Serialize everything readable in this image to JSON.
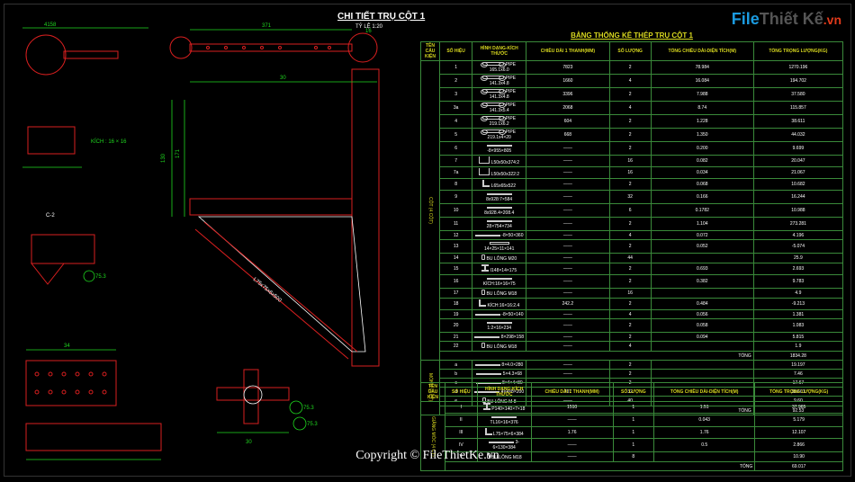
{
  "title": "CHI TIẾT TRỤ CỘT 1",
  "scale": "TỶ LỆ 1:20",
  "logo": {
    "brand_a": "File",
    "brand_b": "Thiết Kế",
    "tld": ".vn"
  },
  "copyright": "Copyright © FileThietKe.vn",
  "dims": {
    "d1": "4158",
    "d2": "371",
    "d3": "16",
    "d4": "30",
    "d5": "171",
    "d6": "130",
    "d7": "75.3",
    "d8": "75.3",
    "d9": "75.3",
    "d10": "34",
    "d11": "30",
    "d12": "75.3",
    "note1": "KÍCH : 16 × 16",
    "note2": "L75x75x6x500"
  },
  "table1": {
    "title": "BẢNG THỐNG KÊ THÉP TRỤ CỘT 1",
    "headers": [
      "TÊN CẤU KIỆN",
      "SỐ HIỆU",
      "HÌNH DẠNG-KÍCH THƯỚC",
      "CHIỀU DÀI 1 THANH(MM)",
      "SỐ LƯỢNG",
      "TỔNG CHIỀU DÀI-DIỆN TÍCH(M)",
      "TỔNG TRỌNG LƯỢNG(KG)"
    ],
    "group1": "CỘT (4 CỘT)",
    "group2": "MÓNG (4 CT)",
    "rows1": [
      {
        "sh": "1",
        "desc": "PIPE 165.1x6.0",
        "len": "7823",
        "sl": "2",
        "tong": "78.984",
        "kg": "1270.196",
        "s": "pipe"
      },
      {
        "sh": "2",
        "desc": "PIPE 141.3x4.8",
        "len": "1660",
        "sl": "4",
        "tong": "16.084",
        "kg": "194.702",
        "s": "pipe"
      },
      {
        "sh": "3",
        "desc": "PIPE 141.3x4.8",
        "len": "3396",
        "sl": "2",
        "tong": "7.988",
        "kg": "37.580",
        "s": "pipe"
      },
      {
        "sh": "3a",
        "desc": "PIPE 141.3x5.4",
        "len": "2068",
        "sl": "4",
        "tong": "8.74",
        "kg": "115.857",
        "s": "pipe"
      },
      {
        "sh": "4",
        "desc": "PIPE 219.1x6.2",
        "len": "604",
        "sl": "2",
        "tong": "1.228",
        "kg": "38.611",
        "s": "pipe"
      },
      {
        "sh": "5",
        "desc": "PIPE 219.1x4×20",
        "len": "668",
        "sl": "2",
        "tong": "1.350",
        "kg": "44.032",
        "s": "pipe"
      },
      {
        "sh": "6",
        "desc": "-8×955×805",
        "len": "——",
        "sl": "2",
        "tong": "0.200",
        "kg": "9.699",
        "s": "plate"
      },
      {
        "sh": "7",
        "desc": "L50x50x374:2",
        "len": "——",
        "sl": "16",
        "tong": "0.082",
        "kg": "20.047",
        "s": "ubeam"
      },
      {
        "sh": "7a",
        "desc": "L50x50x322:2",
        "len": "——",
        "sl": "16",
        "tong": "0.034",
        "kg": "21.067",
        "s": "ubeam"
      },
      {
        "sh": "8",
        "desc": "L65x65x522",
        "len": "——",
        "sl": "2",
        "tong": "0.068",
        "kg": "10.682",
        "s": "lbeam"
      },
      {
        "sh": "9",
        "desc": "8x928:7×584",
        "len": "——",
        "sl": "32",
        "tong": "0.166",
        "kg": "16.244",
        "s": "plate"
      },
      {
        "sh": "10",
        "desc": "8x928.4×208.4",
        "len": "——",
        "sl": "6",
        "tong": "0.1782",
        "kg": "10.988",
        "s": "plate"
      },
      {
        "sh": "11",
        "desc": "28×754×734",
        "len": "——",
        "sl": "2",
        "tong": "1.104",
        "kg": "273.281",
        "s": "plate"
      },
      {
        "sh": "12",
        "desc": "-8×50×360",
        "len": "——",
        "sl": "4",
        "tong": "0.072",
        "kg": "4.196",
        "s": "plate"
      },
      {
        "sh": "13",
        "desc": "14×25×11×141",
        "len": "——",
        "sl": "2",
        "tong": "0.052",
        "kg": "-5.074",
        "s": "bar"
      },
      {
        "sh": "14",
        "desc": "BU LÔNG M20",
        "len": "——",
        "sl": "44",
        "tong": "",
        "kg": "25.9",
        "s": "bolt"
      },
      {
        "sh": "15",
        "desc": "I148×14×175",
        "len": "——",
        "sl": "2",
        "tong": "0.693",
        "kg": "2.693",
        "s": "ibeam"
      },
      {
        "sh": "16",
        "desc": "KÍCH:16×16×75",
        "len": "——",
        "sl": "2",
        "tong": "0.382",
        "kg": "9.783",
        "s": "plate"
      },
      {
        "sh": "17",
        "desc": "BU LÔNG M18",
        "len": "——",
        "sl": "16",
        "tong": "",
        "kg": "4.9",
        "s": "bolt"
      },
      {
        "sh": "18",
        "desc": "KÍCH:16×16:2.4",
        "len": "242.2",
        "sl": "2",
        "tong": "0.484",
        "kg": "-9.213",
        "s": "lbeam"
      },
      {
        "sh": "19",
        "desc": "-8×50×140",
        "len": "——",
        "sl": "4",
        "tong": "0.056",
        "kg": "1.381",
        "s": "plate"
      },
      {
        "sh": "20",
        "desc": "1:2×16×234",
        "len": "——",
        "sl": "2",
        "tong": "0.058",
        "kg": "1.083",
        "s": "plate"
      },
      {
        "sh": "21",
        "desc": "8×298×158",
        "len": "——",
        "sl": "2",
        "tong": "0.094",
        "kg": "5.815",
        "s": "plate"
      },
      {
        "sh": "22",
        "desc": "BU LÔNG M18",
        "len": "——",
        "sl": "4",
        "tong": "",
        "kg": "1.9",
        "s": "bolt"
      }
    ],
    "total1": "1834.28",
    "rows2": [
      {
        "sh": "a",
        "desc": "8×4.0×280",
        "len": "——",
        "sl": "2",
        "tong": "",
        "kg": "19.197",
        "s": "plate"
      },
      {
        "sh": "b",
        "desc": "5×4.3×68",
        "len": "——",
        "sl": "2",
        "tong": "",
        "kg": "7.46",
        "s": "plate"
      },
      {
        "sh": "c",
        "desc": "8×4×4×80",
        "len": "——",
        "sl": "2",
        "tong": "",
        "kg": "17.67",
        "s": "plate"
      },
      {
        "sh": "d",
        "desc": "4×4×8×200",
        "len": "707",
        "sl": "32",
        "tong": "",
        "kg": "38.601",
        "s": "plate"
      },
      {
        "sh": "e",
        "desc": "BU LÔNG M 8",
        "len": "——",
        "sl": "40",
        "tong": "",
        "kg": "9.60",
        "s": "bolt"
      }
    ],
    "total2": "92.53"
  },
  "table2": {
    "headers": [
      "TÊN CẤU KIỆN",
      "SỐ HIỆU",
      "HÌNH DẠNG-KÍCH THƯỚC",
      "CHIỀU DÀI 1 THANH(MM)",
      "SỐ LƯỢNG",
      "TỔNG CHIỀU DÀI-DIỆN TÍCH(M)",
      "TỔNG TRỌNG LƯỢNG(KG)"
    ],
    "group": "GIẰNG MÓC (4 CT)",
    "rows": [
      {
        "sh": "I",
        "desc": "P140×140×7×18",
        "len": "1510",
        "sl": "1",
        "tong": "1.51",
        "kg": "37.965",
        "s": "ibeam"
      },
      {
        "sh": "II",
        "desc": "TL16×16×376",
        "len": "——",
        "sl": "1",
        "tong": "0.043",
        "kg": "5.179",
        "s": "plate"
      },
      {
        "sh": "III",
        "desc": "L75×75×6×384",
        "len": "1.76",
        "sl": "1",
        "tong": "1.76",
        "kg": "12.107",
        "s": "lbeam"
      },
      {
        "sh": "IV",
        "desc": "3-6×130×384",
        "len": "——",
        "sl": "1",
        "tong": "0.5",
        "kg": "2.866",
        "s": "plate"
      },
      {
        "sh": "V",
        "desc": "BU LÔNG M18",
        "len": "——",
        "sl": "8",
        "tong": "",
        "kg": "10.90",
        "s": "bolt"
      }
    ],
    "total": "69.017",
    "total_label": "TỔNG"
  }
}
